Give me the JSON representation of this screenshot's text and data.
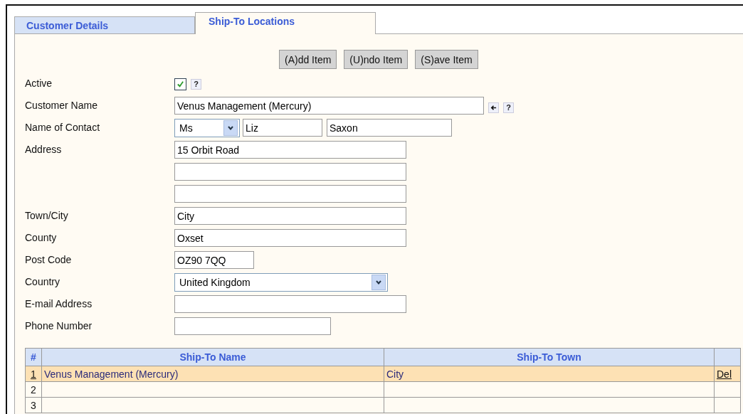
{
  "tabs": [
    {
      "label": "Customer Details",
      "selected": false
    },
    {
      "label": "Ship-To Locations",
      "selected": true
    }
  ],
  "buttons": [
    "(A)dd Item",
    "(U)ndo Item",
    "(S)ave Item"
  ],
  "fields": [
    {
      "kind": "checkbox",
      "label": "Active",
      "checked": true,
      "help": "?"
    },
    {
      "kind": "text",
      "label": "Customer Name",
      "value": "Venus Management (Mercury)",
      "back": true,
      "help": "?"
    },
    {
      "kind": "contact",
      "label": "Name of Contact",
      "title": "Ms",
      "first": "Liz",
      "last": "Saxon"
    },
    {
      "kind": "lines",
      "label": "Address",
      "lines": [
        {
          "kind": "filled",
          "value": "15 Orbit Road"
        },
        {
          "kind": "blank"
        },
        {
          "kind": "blank"
        }
      ]
    },
    {
      "kind": "text",
      "label": "Town/City",
      "value": "City"
    },
    {
      "kind": "text",
      "label": "County",
      "value": "Oxset"
    },
    {
      "kind": "text",
      "label": "Post Code",
      "value": "OZ90 7QQ"
    },
    {
      "kind": "select",
      "label": "Country",
      "value": "United Kingdom"
    },
    {
      "kind": "text",
      "label": "E-mail Address"
    },
    {
      "kind": "text",
      "label": "Phone Number"
    }
  ],
  "table": {
    "columns": [
      "#",
      "Ship-To Name",
      "Ship-To Town"
    ],
    "rows": [
      {
        "number": "1",
        "name": "Venus Management (Mercury)",
        "town": "City",
        "action": "Del",
        "selected": true
      },
      {
        "number": "2",
        "selected": false
      },
      {
        "number": "3",
        "selected": false
      }
    ]
  }
}
